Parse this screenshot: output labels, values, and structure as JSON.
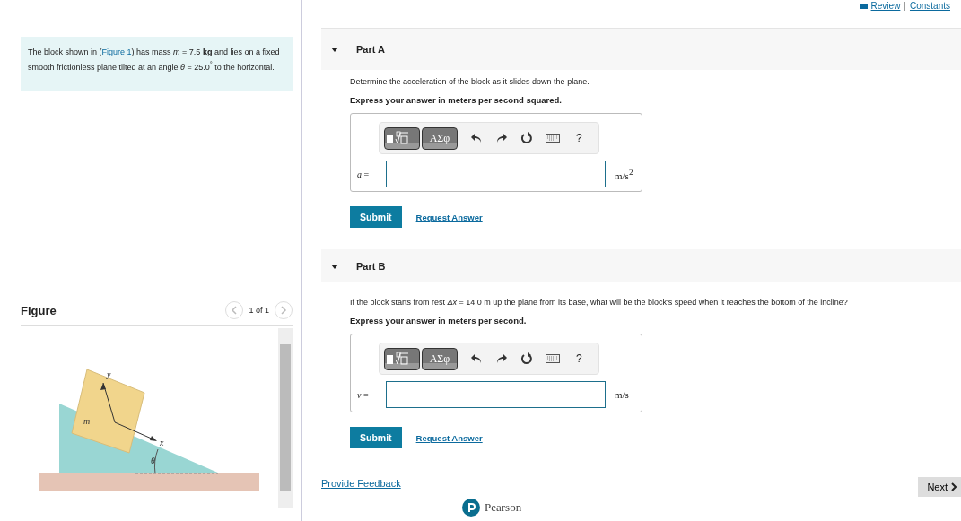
{
  "top_links": [
    "Review",
    "Constants"
  ],
  "top_separator": "|",
  "intro": {
    "before": "The block shown in (",
    "link": "Figure 1",
    "after": ") has mass *m* = 7.5 **kg** and lies on a fixed smooth frictionless plane tilted at an angle *θ* = 25.0$^{°}$ to the horizontal."
  },
  "figure": {
    "title": "Figure",
    "pager": "1 of 1",
    "labels": {
      "y": "y",
      "x": "x",
      "mass": "m",
      "angle": "θ"
    }
  },
  "parts": [
    {
      "title": "Part A",
      "expanded": true,
      "prompt": "Determine the acceleration of the block as it slides down the plane.",
      "instruction": "Express your answer in meters per second squared.",
      "toolbar": {
        "symbols": "ΑΣφ",
        "help": "?"
      },
      "variable": "*a* =",
      "unit": "m/s$^{2}$",
      "submit": "Submit",
      "request": "Request Answer"
    },
    {
      "title": "Part B",
      "expanded": true,
      "prompt": "If the block starts from rest *Δx* = 14.0 m up the plane from its base, what will be the block's speed when it reaches the bottom of the incline?",
      "instruction": "Express your answer in meters per second.",
      "toolbar": {
        "symbols": "ΑΣφ",
        "help": "?"
      },
      "variable": "*v* =",
      "unit": "m/s",
      "submit": "Submit",
      "request": "Request Answer"
    }
  ],
  "feedback": "Provide Feedback",
  "next": "Next",
  "brand": "Pearson"
}
